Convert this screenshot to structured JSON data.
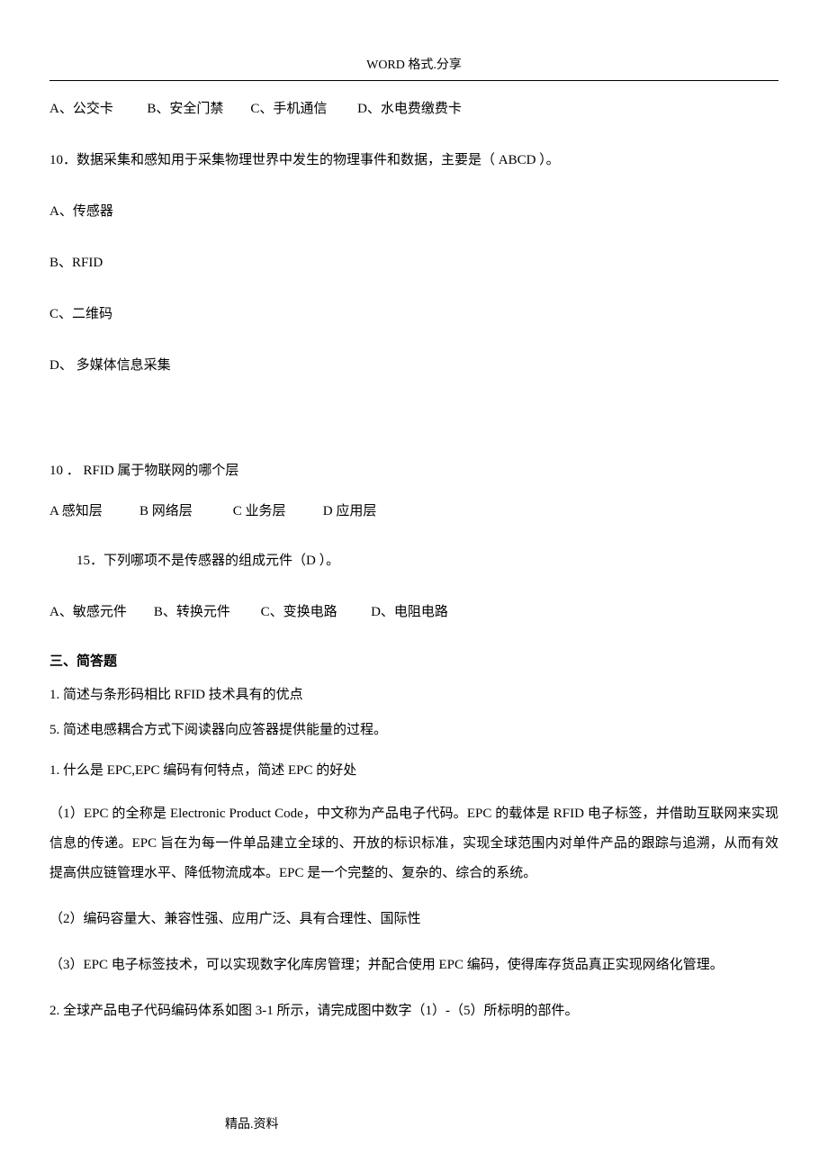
{
  "header": {
    "title": "WORD 格式.分享"
  },
  "q9_options": "A、公交卡          B、安全门禁        C、手机通信         D、水电费缴费卡",
  "q10": {
    "text": "10．数据采集和感知用于采集物理世界中发生的物理事件和数据，主要是（ ABCD ）。",
    "optA": "A、传感器",
    "optB": "B、RFID",
    "optC": "C、二维码",
    "optD": "D、 多媒体信息采集"
  },
  "q10b": {
    "text": "10 ． RFID 属于物联网的哪个层",
    "options": "A 感知层           B 网络层            C 业务层           D 应用层"
  },
  "q15": {
    "text": "15．下列哪项不是传感器的组成元件（D ）。",
    "options": "A、敏感元件        B、转换元件         C、变换电路          D、电阻电路"
  },
  "section3": {
    "title": "三、简答题",
    "q1": "1.  简述与条形码相比 RFID 技术具有的优点",
    "q5": "5.  简述电感耦合方式下阅读器向应答器提供能量的过程。",
    "q1b": "1.  什么是 EPC,EPC 编码有何特点，简述 EPC 的好处",
    "ans1": "（1）EPC 的全称是 Electronic Product Code，中文称为产品电子代码。EPC 的载体是 RFID 电子标签，并借助互联网来实现信息的传递。EPC 旨在为每一件单品建立全球的、开放的标识标准，实现全球范围内对单件产品的跟踪与追溯，从而有效提高供应链管理水平、降低物流成本。EPC 是一个完整的、复杂的、综合的系统。",
    "ans2": "（2）编码容量大、兼容性强、应用广泛、具有合理性、国际性",
    "ans3": "（3）EPC 电子标签技术，可以实现数字化库房管理；并配合使用 EPC 编码，使得库存货品真正实现网络化管理。",
    "q2": "2.  全球产品电子代码编码体系如图 3-1 所示，请完成图中数字（1）-（5）所标明的部件。"
  },
  "footer": "精品.资料"
}
